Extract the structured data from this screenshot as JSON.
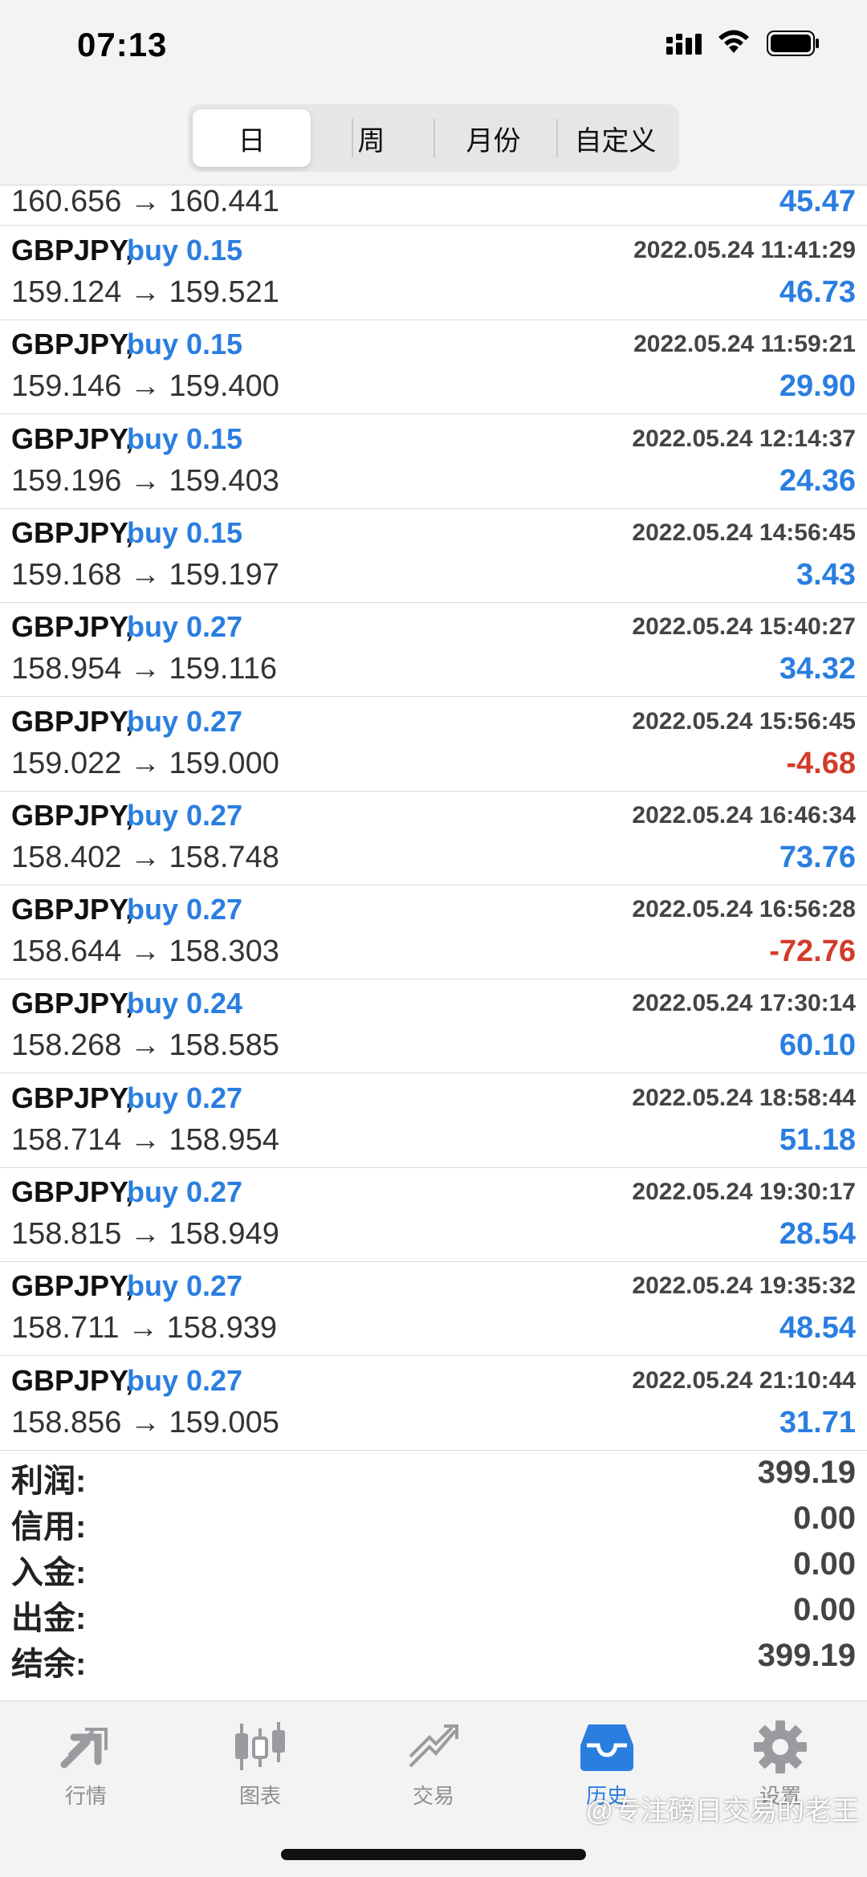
{
  "status": {
    "time": "07:13"
  },
  "segments": [
    "日",
    "周",
    "月份",
    "自定义"
  ],
  "partial_row": {
    "prices": "160.656 → 160.441",
    "profit": "45.47"
  },
  "trades": [
    {
      "symbol": "GBPJPY,",
      "side": "buy 0.15",
      "datetime": "2022.05.24 11:41:29",
      "prices": "159.124 → 159.521",
      "profit": "46.73",
      "negative": false
    },
    {
      "symbol": "GBPJPY,",
      "side": "buy 0.15",
      "datetime": "2022.05.24 11:59:21",
      "prices": "159.146 → 159.400",
      "profit": "29.90",
      "negative": false
    },
    {
      "symbol": "GBPJPY,",
      "side": "buy 0.15",
      "datetime": "2022.05.24 12:14:37",
      "prices": "159.196 → 159.403",
      "profit": "24.36",
      "negative": false
    },
    {
      "symbol": "GBPJPY,",
      "side": "buy 0.15",
      "datetime": "2022.05.24 14:56:45",
      "prices": "159.168 → 159.197",
      "profit": "3.43",
      "negative": false
    },
    {
      "symbol": "GBPJPY,",
      "side": "buy 0.27",
      "datetime": "2022.05.24 15:40:27",
      "prices": "158.954 → 159.116",
      "profit": "34.32",
      "negative": false
    },
    {
      "symbol": "GBPJPY,",
      "side": "buy 0.27",
      "datetime": "2022.05.24 15:56:45",
      "prices": "159.022 → 159.000",
      "profit": "-4.68",
      "negative": true
    },
    {
      "symbol": "GBPJPY,",
      "side": "buy 0.27",
      "datetime": "2022.05.24 16:46:34",
      "prices": "158.402 → 158.748",
      "profit": "73.76",
      "negative": false
    },
    {
      "symbol": "GBPJPY,",
      "side": "buy 0.27",
      "datetime": "2022.05.24 16:56:28",
      "prices": "158.644 → 158.303",
      "profit": "-72.76",
      "negative": true
    },
    {
      "symbol": "GBPJPY,",
      "side": "buy 0.24",
      "datetime": "2022.05.24 17:30:14",
      "prices": "158.268 → 158.585",
      "profit": "60.10",
      "negative": false
    },
    {
      "symbol": "GBPJPY,",
      "side": "buy 0.27",
      "datetime": "2022.05.24 18:58:44",
      "prices": "158.714 → 158.954",
      "profit": "51.18",
      "negative": false
    },
    {
      "symbol": "GBPJPY,",
      "side": "buy 0.27",
      "datetime": "2022.05.24 19:30:17",
      "prices": "158.815 → 158.949",
      "profit": "28.54",
      "negative": false
    },
    {
      "symbol": "GBPJPY,",
      "side": "buy 0.27",
      "datetime": "2022.05.24 19:35:32",
      "prices": "158.711 → 158.939",
      "profit": "48.54",
      "negative": false
    },
    {
      "symbol": "GBPJPY,",
      "side": "buy 0.27",
      "datetime": "2022.05.24 21:10:44",
      "prices": "158.856 → 159.005",
      "profit": "31.71",
      "negative": false
    }
  ],
  "summary": [
    {
      "label": "利润:",
      "value": "399.19"
    },
    {
      "label": "信用:",
      "value": "0.00"
    },
    {
      "label": "入金:",
      "value": "0.00"
    },
    {
      "label": "出金:",
      "value": "0.00"
    },
    {
      "label": "结余:",
      "value": "399.19"
    }
  ],
  "tabs": [
    {
      "label": "行情",
      "icon": "quotes-icon",
      "active": false
    },
    {
      "label": "图表",
      "icon": "chart-icon",
      "active": false
    },
    {
      "label": "交易",
      "icon": "trade-icon",
      "active": false
    },
    {
      "label": "历史",
      "icon": "history-icon",
      "active": true
    },
    {
      "label": "设置",
      "icon": "settings-icon",
      "active": false
    }
  ],
  "watermark": "@专注磅日交易的老王",
  "colors": {
    "accent": "#2a7ee0",
    "negative": "#d23b2a",
    "inactive": "#8e8e93"
  }
}
